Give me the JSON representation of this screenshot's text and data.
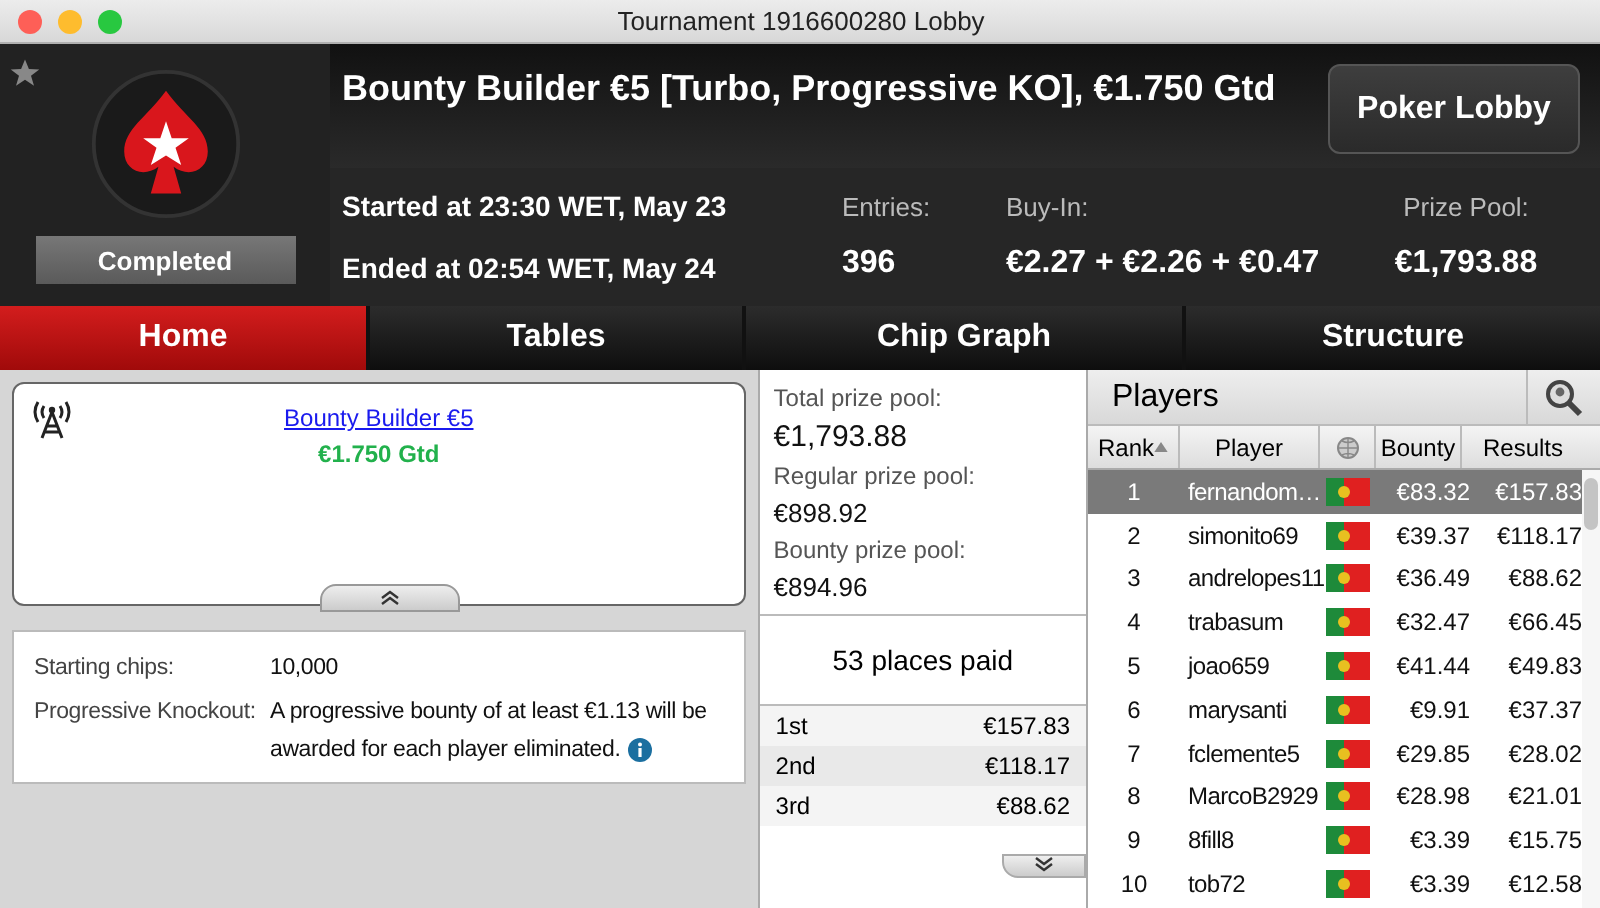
{
  "window": {
    "title": "Tournament 1916600280 Lobby"
  },
  "header": {
    "name": "Bounty Builder €5 [Turbo, Progressive KO], €1.750 Gtd",
    "status": "Completed",
    "started": "Started at 23:30 WET, May 23",
    "ended": "Ended at 02:54 WET, May 24",
    "lobby_button": "Poker Lobby",
    "stats": [
      {
        "label": "Entries:",
        "value": "396"
      },
      {
        "label": "Buy-In:",
        "value": "€2.27 + €2.26 + €0.47"
      },
      {
        "label": "Prize Pool:",
        "value": "€1,793.88"
      }
    ]
  },
  "tabs": [
    {
      "label": "Home",
      "selected": true
    },
    {
      "label": "Tables",
      "selected": false
    },
    {
      "label": "Chip Graph",
      "selected": false
    },
    {
      "label": "Structure",
      "selected": false
    }
  ],
  "banner": {
    "link": "Bounty Builder €5",
    "guarantee": "€1.750 Gtd"
  },
  "details": [
    {
      "label": "Starting chips:",
      "value": "10,000"
    },
    {
      "label": "Progressive Knockout:",
      "value": "A progressive bounty of at least €1.13 will be awarded for each player eliminated."
    }
  ],
  "prize_pool": [
    {
      "label": "Total prize pool:",
      "value": "€1,793.88"
    },
    {
      "label": "Regular prize pool:",
      "value": "€898.92"
    },
    {
      "label": "Bounty prize pool:",
      "value": "€894.96"
    }
  ],
  "places_paid": "53 places paid",
  "payouts": [
    {
      "place": "1st",
      "amount": "€157.83"
    },
    {
      "place": "2nd",
      "amount": "€118.17"
    },
    {
      "place": "3rd",
      "amount": "€88.62"
    }
  ],
  "players": {
    "title": "Players",
    "columns": [
      "Rank",
      "Player",
      "Bounty",
      "Results"
    ],
    "rows": [
      {
        "rank": "1",
        "name": "fernandom…",
        "bounty": "€83.32",
        "result": "€157.83",
        "selected": true
      },
      {
        "rank": "2",
        "name": "simonito69",
        "bounty": "€39.37",
        "result": "€118.17",
        "selected": false
      },
      {
        "rank": "3",
        "name": "andrelopes11",
        "bounty": "€36.49",
        "result": "€88.62",
        "selected": false
      },
      {
        "rank": "4",
        "name": "trabasum",
        "bounty": "€32.47",
        "result": "€66.45",
        "selected": false
      },
      {
        "rank": "5",
        "name": "joao659",
        "bounty": "€41.44",
        "result": "€49.83",
        "selected": false
      },
      {
        "rank": "6",
        "name": "marysanti",
        "bounty": "€9.91",
        "result": "€37.37",
        "selected": false
      },
      {
        "rank": "7",
        "name": "fclemente5",
        "bounty": "€29.85",
        "result": "€28.02",
        "selected": false
      },
      {
        "rank": "8",
        "name": "MarcoB2929",
        "bounty": "€28.98",
        "result": "€21.01",
        "selected": false
      },
      {
        "rank": "9",
        "name": "8fill8",
        "bounty": "€3.39",
        "result": "€15.75",
        "selected": false
      },
      {
        "rank": "10",
        "name": "tob72",
        "bounty": "€3.39",
        "result": "€12.58",
        "selected": false
      }
    ]
  }
}
